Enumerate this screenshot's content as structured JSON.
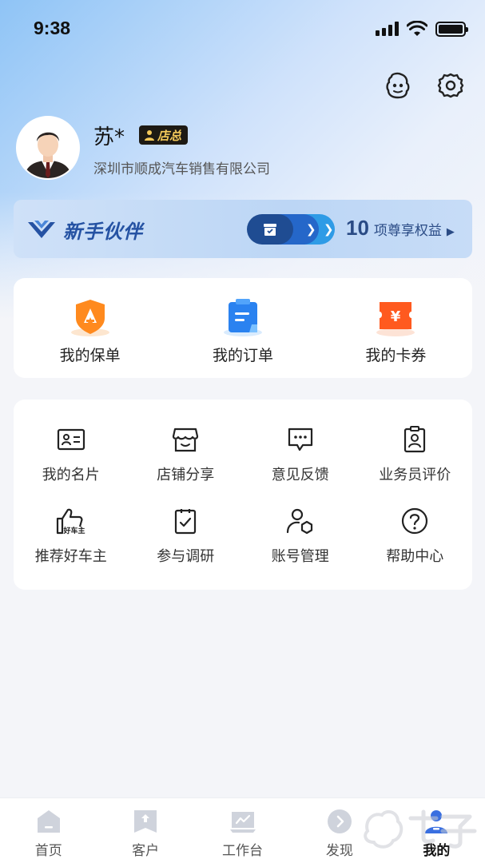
{
  "status_bar": {
    "time": "9:38"
  },
  "colors": {
    "primary": "#2567c9",
    "badge_gold": "#f3c95a",
    "accent_orange": "#ff7a1a",
    "tab_active": "#3a6fe0"
  },
  "header": {
    "actions": [
      "robot-icon",
      "settings-icon"
    ]
  },
  "profile": {
    "name": "苏*",
    "role_badge": "店总",
    "company": "深圳市顺成汽车销售有限公司"
  },
  "banner": {
    "title": "新手伙伴",
    "benefit_count": "10",
    "benefit_text": "项尊享权益"
  },
  "quick_links": [
    {
      "label": "我的保单",
      "icon": "policy-icon"
    },
    {
      "label": "我的订单",
      "icon": "order-icon"
    },
    {
      "label": "我的卡券",
      "icon": "coupon-icon"
    }
  ],
  "tools": [
    {
      "label": "我的名片",
      "icon": "business-card-icon"
    },
    {
      "label": "店铺分享",
      "icon": "store-icon"
    },
    {
      "label": "意见反馈",
      "icon": "feedback-icon"
    },
    {
      "label": "业务员评价",
      "icon": "salesperson-rating-icon"
    },
    {
      "label": "推荐好车主",
      "icon": "thumbs-up-icon",
      "icon_text": "好车主"
    },
    {
      "label": "参与调研",
      "icon": "survey-icon"
    },
    {
      "label": "账号管理",
      "icon": "account-icon"
    },
    {
      "label": "帮助中心",
      "icon": "help-icon"
    }
  ],
  "tabs": [
    {
      "label": "首页",
      "icon": "home-icon"
    },
    {
      "label": "客户",
      "icon": "customer-icon"
    },
    {
      "label": "工作台",
      "icon": "workbench-icon"
    },
    {
      "label": "发现",
      "icon": "discover-icon"
    },
    {
      "label": "我的",
      "icon": "profile-icon",
      "active": true
    }
  ]
}
